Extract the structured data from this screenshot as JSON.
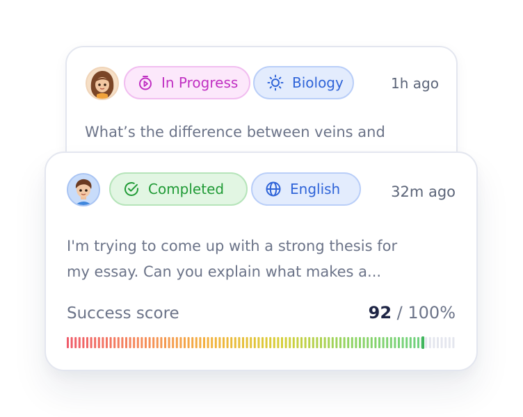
{
  "cards": [
    {
      "status": "In Progress",
      "topic": "Biology",
      "time": "1h ago",
      "text": "What’s the difference between veins and",
      "status_icon": "timer-icon",
      "topic_icon": "sun-icon",
      "avatar": "girl-avatar"
    },
    {
      "status": "Completed",
      "topic": "English",
      "time": "32m ago",
      "text_lines": [
        "I'm trying to come up with a strong thesis for",
        "my essay. Can you explain what makes a..."
      ],
      "status_icon": "check-circle-icon",
      "topic_icon": "globe-icon",
      "avatar": "boy-avatar",
      "score": {
        "label": "Success score",
        "value": "92",
        "max": "/ 100%",
        "percent": 92
      }
    }
  ],
  "colors": {
    "progress_pill": "#c02fc2",
    "topic_pill": "#2e63d8",
    "completed_pill": "#1f9a35",
    "score_gradient": [
      "#ef5b6a",
      "#f58a5b",
      "#f3b23e",
      "#d7cf38",
      "#8fd464",
      "#6fd17f"
    ],
    "bar_empty": "#e4e6ee"
  }
}
